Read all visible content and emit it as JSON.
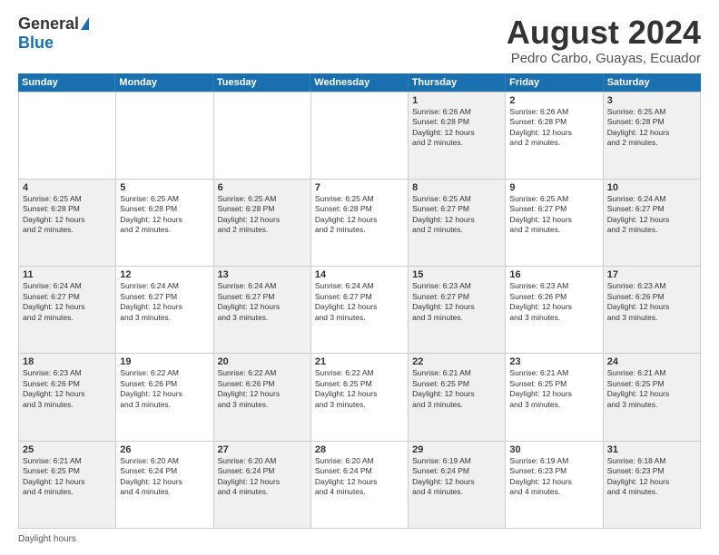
{
  "header": {
    "logo_general": "General",
    "logo_blue": "Blue",
    "title": "August 2024",
    "subtitle": "Pedro Carbo, Guayas, Ecuador"
  },
  "days_of_week": [
    "Sunday",
    "Monday",
    "Tuesday",
    "Wednesday",
    "Thursday",
    "Friday",
    "Saturday"
  ],
  "weeks": [
    [
      {
        "day": "",
        "info": ""
      },
      {
        "day": "",
        "info": ""
      },
      {
        "day": "",
        "info": ""
      },
      {
        "day": "",
        "info": ""
      },
      {
        "day": "1",
        "info": "Sunrise: 6:26 AM\nSunset: 6:28 PM\nDaylight: 12 hours\nand 2 minutes."
      },
      {
        "day": "2",
        "info": "Sunrise: 6:26 AM\nSunset: 6:28 PM\nDaylight: 12 hours\nand 2 minutes."
      },
      {
        "day": "3",
        "info": "Sunrise: 6:25 AM\nSunset: 6:28 PM\nDaylight: 12 hours\nand 2 minutes."
      }
    ],
    [
      {
        "day": "4",
        "info": "Sunrise: 6:25 AM\nSunset: 6:28 PM\nDaylight: 12 hours\nand 2 minutes."
      },
      {
        "day": "5",
        "info": "Sunrise: 6:25 AM\nSunset: 6:28 PM\nDaylight: 12 hours\nand 2 minutes."
      },
      {
        "day": "6",
        "info": "Sunrise: 6:25 AM\nSunset: 6:28 PM\nDaylight: 12 hours\nand 2 minutes."
      },
      {
        "day": "7",
        "info": "Sunrise: 6:25 AM\nSunset: 6:28 PM\nDaylight: 12 hours\nand 2 minutes."
      },
      {
        "day": "8",
        "info": "Sunrise: 6:25 AM\nSunset: 6:27 PM\nDaylight: 12 hours\nand 2 minutes."
      },
      {
        "day": "9",
        "info": "Sunrise: 6:25 AM\nSunset: 6:27 PM\nDaylight: 12 hours\nand 2 minutes."
      },
      {
        "day": "10",
        "info": "Sunrise: 6:24 AM\nSunset: 6:27 PM\nDaylight: 12 hours\nand 2 minutes."
      }
    ],
    [
      {
        "day": "11",
        "info": "Sunrise: 6:24 AM\nSunset: 6:27 PM\nDaylight: 12 hours\nand 2 minutes."
      },
      {
        "day": "12",
        "info": "Sunrise: 6:24 AM\nSunset: 6:27 PM\nDaylight: 12 hours\nand 3 minutes."
      },
      {
        "day": "13",
        "info": "Sunrise: 6:24 AM\nSunset: 6:27 PM\nDaylight: 12 hours\nand 3 minutes."
      },
      {
        "day": "14",
        "info": "Sunrise: 6:24 AM\nSunset: 6:27 PM\nDaylight: 12 hours\nand 3 minutes."
      },
      {
        "day": "15",
        "info": "Sunrise: 6:23 AM\nSunset: 6:27 PM\nDaylight: 12 hours\nand 3 minutes."
      },
      {
        "day": "16",
        "info": "Sunrise: 6:23 AM\nSunset: 6:26 PM\nDaylight: 12 hours\nand 3 minutes."
      },
      {
        "day": "17",
        "info": "Sunrise: 6:23 AM\nSunset: 6:26 PM\nDaylight: 12 hours\nand 3 minutes."
      }
    ],
    [
      {
        "day": "18",
        "info": "Sunrise: 6:23 AM\nSunset: 6:26 PM\nDaylight: 12 hours\nand 3 minutes."
      },
      {
        "day": "19",
        "info": "Sunrise: 6:22 AM\nSunset: 6:26 PM\nDaylight: 12 hours\nand 3 minutes."
      },
      {
        "day": "20",
        "info": "Sunrise: 6:22 AM\nSunset: 6:26 PM\nDaylight: 12 hours\nand 3 minutes."
      },
      {
        "day": "21",
        "info": "Sunrise: 6:22 AM\nSunset: 6:25 PM\nDaylight: 12 hours\nand 3 minutes."
      },
      {
        "day": "22",
        "info": "Sunrise: 6:21 AM\nSunset: 6:25 PM\nDaylight: 12 hours\nand 3 minutes."
      },
      {
        "day": "23",
        "info": "Sunrise: 6:21 AM\nSunset: 6:25 PM\nDaylight: 12 hours\nand 3 minutes."
      },
      {
        "day": "24",
        "info": "Sunrise: 6:21 AM\nSunset: 6:25 PM\nDaylight: 12 hours\nand 3 minutes."
      }
    ],
    [
      {
        "day": "25",
        "info": "Sunrise: 6:21 AM\nSunset: 6:25 PM\nDaylight: 12 hours\nand 4 minutes."
      },
      {
        "day": "26",
        "info": "Sunrise: 6:20 AM\nSunset: 6:24 PM\nDaylight: 12 hours\nand 4 minutes."
      },
      {
        "day": "27",
        "info": "Sunrise: 6:20 AM\nSunset: 6:24 PM\nDaylight: 12 hours\nand 4 minutes."
      },
      {
        "day": "28",
        "info": "Sunrise: 6:20 AM\nSunset: 6:24 PM\nDaylight: 12 hours\nand 4 minutes."
      },
      {
        "day": "29",
        "info": "Sunrise: 6:19 AM\nSunset: 6:24 PM\nDaylight: 12 hours\nand 4 minutes."
      },
      {
        "day": "30",
        "info": "Sunrise: 6:19 AM\nSunset: 6:23 PM\nDaylight: 12 hours\nand 4 minutes."
      },
      {
        "day": "31",
        "info": "Sunrise: 6:18 AM\nSunset: 6:23 PM\nDaylight: 12 hours\nand 4 minutes."
      }
    ]
  ],
  "footer": {
    "daylight_label": "Daylight hours"
  }
}
